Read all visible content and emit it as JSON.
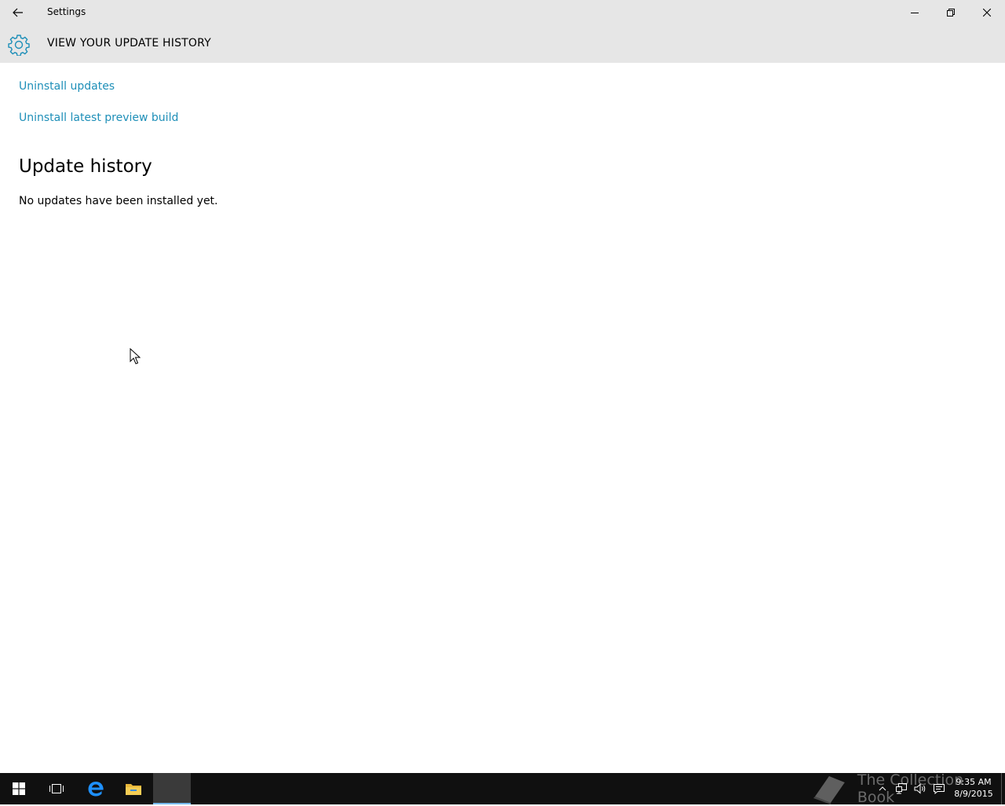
{
  "window": {
    "title": "Settings"
  },
  "header": {
    "page_title": "VIEW YOUR UPDATE HISTORY"
  },
  "links": {
    "uninstall_updates": "Uninstall updates",
    "uninstall_preview_build": "Uninstall latest preview build"
  },
  "history": {
    "title": "Update history",
    "empty_text": "No updates have been installed yet."
  },
  "taskbar": {
    "watermark": "The Collection Book",
    "time": "9:35 AM",
    "date": "8/9/2015"
  },
  "colors": {
    "accent": "#1e8fb8",
    "titlebar_bg": "#e6e6e6",
    "taskbar_bg": "#101010",
    "active_indicator": "#76b9ed"
  },
  "icons": {
    "back": "back-arrow-icon",
    "header": "gear-icon",
    "minimize": "minimize-icon",
    "restore": "restore-icon",
    "close": "close-icon",
    "start": "windows-logo-icon",
    "task_view": "task-view-icon",
    "edge": "edge-browser-icon",
    "explorer": "file-explorer-icon"
  }
}
